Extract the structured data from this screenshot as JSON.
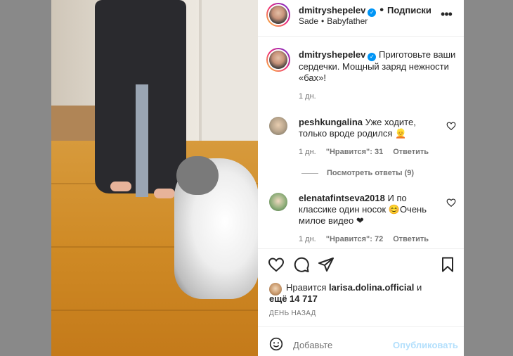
{
  "header": {
    "username": "dmitryshepelev",
    "follow_label": "Подписки",
    "audio_artist": "Sade",
    "audio_track": "Babyfather"
  },
  "caption": {
    "username": "dmitryshepelev",
    "text": "Приготовьте ваши сердечки. Мощный заряд нежности «бах»!",
    "time": "1 дн."
  },
  "comments": [
    {
      "username": "peshkungalina",
      "text": "Уже ходите, только вроде родился 👱",
      "time": "1 дн.",
      "likes": "\"Нравится\": 31",
      "reply_label": "Ответить"
    },
    {
      "username": "elenatafintseva2018",
      "text": "И по классике один носок 😊Очень милое видео ❤",
      "time": "1 дн.",
      "likes": "\"Нравится\": 72",
      "reply_label": "Ответить"
    }
  ],
  "view_replies_label": "Посмотреть ответы (9)",
  "likes_summary": {
    "prefix": "Нравится",
    "user": "larisa.dolina.official",
    "and": "и",
    "rest": "ещё 14 717"
  },
  "days_ago": "ДЕНЬ НАЗАД",
  "add_comment": {
    "placeholder": "Добавьте",
    "publish_label": "Опубликовать"
  },
  "colors": {
    "verified": "#0095f6",
    "publish_disabled": "#b2dffc",
    "secondary_text": "#737373"
  }
}
